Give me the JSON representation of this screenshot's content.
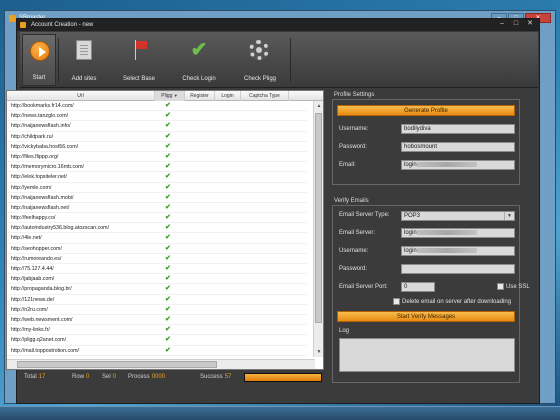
{
  "outer_window": {
    "title": "SBmaster"
  },
  "inner_window": {
    "title": "Account Creation - new"
  },
  "toolbar": {
    "start": "Start",
    "add_sites": "Add sites",
    "select_base": "Select Base",
    "check_login": "Check Login",
    "check_pligg": "Check Pligg"
  },
  "grid": {
    "columns": {
      "url": "Url",
      "pligg": "Pligg",
      "register": "Register",
      "login": "Login",
      "captcha": "Captcha Type"
    },
    "check_glyph": "✔",
    "rows": [
      "http://bookmarks.fr14.com/",
      "http://news.tanzglo.com/",
      "http://naijanewsflash.info/",
      "http://childpark.ru/",
      "http://vickybaba.host56.com/",
      "http://files.flippp.org/",
      "http://memorymicro.16mb.com/",
      "http://elok.topsiteler.net/",
      "http://yemle.com/",
      "http://naijanewsflash.mobi/",
      "http://naijanewsflash.net/",
      "http://feelhappy.co/",
      "http://autoindustry536.blog.atozscan.com/",
      "http://4le.net/",
      "http://seohopper.com/",
      "http://rumoreando.es/",
      "http://75.127.4.44/",
      "http://jabjaab.com/",
      "http://propaganda.blog.br/",
      "http://121news.de/",
      "http://n2ru.com/",
      "http://web.newsment.com/",
      "http://my-links.fr/",
      "http://pligg.q2anet.com/",
      "http://mail.toppostrotion.com/"
    ]
  },
  "status": {
    "total_label": "Total",
    "total_value": "17",
    "row_label": "Row",
    "row_value": "0",
    "sel_label": "Sel",
    "sel_value": "0",
    "process_label": "Process",
    "process_value": "0000",
    "success_label": "Success",
    "success_value": "57",
    "progress_fraction": 1.0
  },
  "profile": {
    "section_title": "Profile Settings",
    "generate_button": "Generate Profile",
    "username_label": "Username:",
    "username_value": "bodilydiva",
    "password_label": "Password:",
    "password_value": "hobosmount",
    "email_label": "Email:",
    "email_prefix": "login"
  },
  "verify": {
    "section_title": "Verify Emails",
    "server_type_label": "Email Server Type:",
    "server_type_value": "POP3",
    "server_label": "Email Server:",
    "server_prefix": "login",
    "username_label": "Username:",
    "username_prefix": "login",
    "password_label": "Password:",
    "port_label": "Email Server Port:",
    "port_value": "0",
    "ssl_label": "Use SSL",
    "delete_label": "Delete email on server after downloading",
    "start_button": "Start Verify Messages",
    "log_label": "Log"
  }
}
